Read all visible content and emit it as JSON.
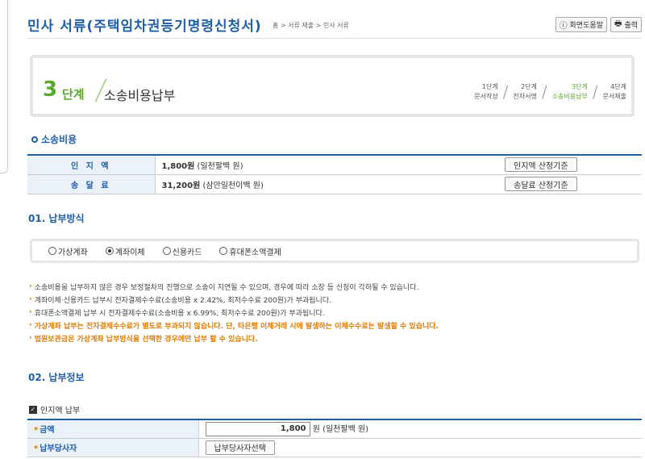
{
  "header": {
    "title": "민사 서류(주택임차권등기명령신청서)",
    "breadcrumb": "홈 > 서류 제출 > 민사 서류",
    "help_label": "화면도움말",
    "print_label": "출력"
  },
  "step": {
    "number": "3",
    "unit": "단계",
    "title": "소송비용납부",
    "items": [
      {
        "num": "1단계",
        "label": "문서작성",
        "active": false
      },
      {
        "num": "2단계",
        "label": "전자서명",
        "active": false
      },
      {
        "num": "3단계",
        "label": "소송비용납부",
        "active": true
      },
      {
        "num": "4단계",
        "label": "문서제출",
        "active": false
      }
    ]
  },
  "cost": {
    "section_title": "소송비용",
    "rows": [
      {
        "label": "인 지 액",
        "amount": "1,800원",
        "amount_text": "(일천팔백 원)",
        "button": "인지액 산정기준"
      },
      {
        "label": "송 달 료",
        "amount": "31,200원",
        "amount_text": "(삼만일천이백 원)",
        "button": "송달료 산정기준"
      }
    ]
  },
  "payment_method": {
    "section_title": "01. 납부방식",
    "options": [
      {
        "label": "가상계좌",
        "checked": false
      },
      {
        "label": "계좌이체",
        "checked": true
      },
      {
        "label": "신용카드",
        "checked": false
      },
      {
        "label": "휴대폰소액결제",
        "checked": false
      }
    ]
  },
  "notes": [
    {
      "text": "소송비용을 납부하지 않은 경우 보정절차의 진행으로 소송이 지연될 수 있으며, 경우에 따라 소장 등 신청이 각하될 수 있습니다.",
      "highlight": false
    },
    {
      "text": "계좌이체·신용카드 납부시 전자결제수수료(소송비용 x 2.42%, 최저수수료 200원)가 부과됩니다.",
      "highlight": false
    },
    {
      "text": "휴대폰소액결제 납부 시 전자결제수수료(소송비용 x 6.99%, 최저수수료 200원)가 부과됩니다.",
      "highlight": false
    },
    {
      "text": "가상계좌 납부는 전자결제수수료가 별도로 부과되지 않습니다. 단, 타은행 이체거래 시에 발생하는 이체수수료는 발생할 수 있습니다.",
      "highlight": true
    },
    {
      "text": "법원보관금은 가상계좌 납부방식을 선택한 경우에만 납부 할 수 있습니다.",
      "highlight": true
    }
  ],
  "payment_info": {
    "section_title": "02. 납부정보",
    "checkbox_label": "인지액 납부",
    "amount_label": "금액",
    "amount_value": "1,800",
    "amount_suffix": "원 (일천팔백 원)",
    "payer_label": "납부당사자",
    "payer_button": "납부당사자선택"
  }
}
